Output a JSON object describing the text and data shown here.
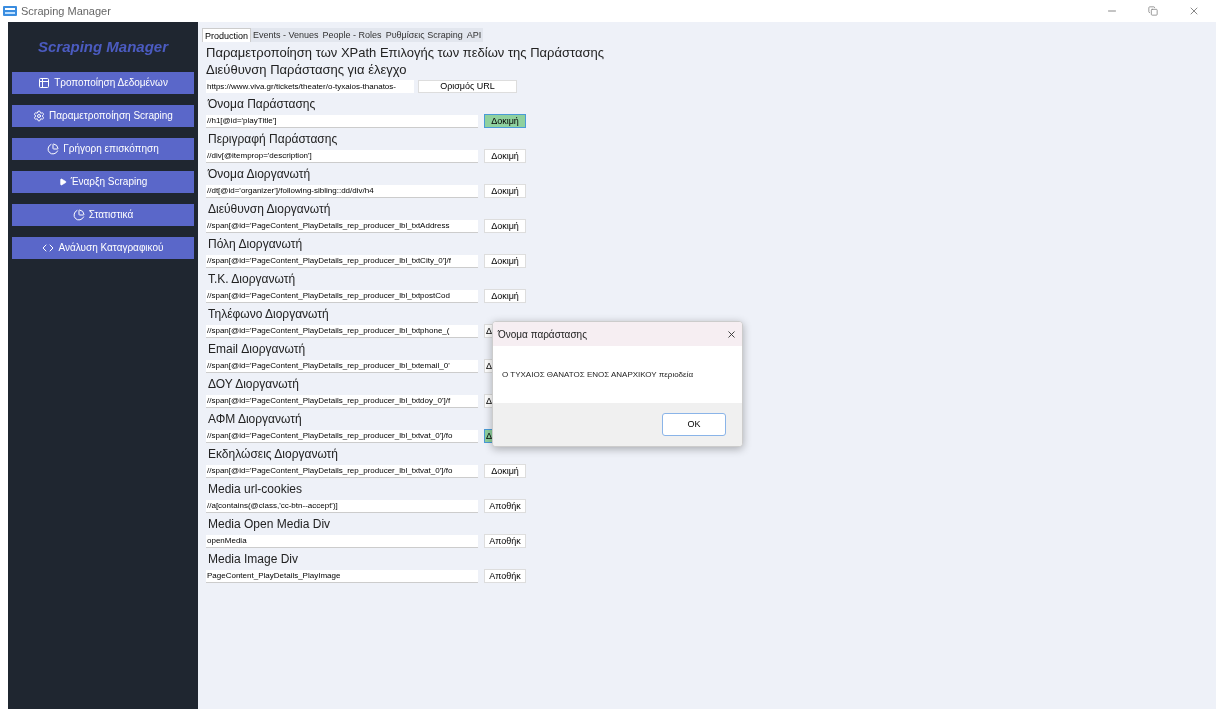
{
  "window": {
    "title": "Scraping Manager"
  },
  "sidebar": {
    "title": "Scraping Manager",
    "items": [
      {
        "label": "Τροποποίηση Δεδομένων",
        "kind": "table"
      },
      {
        "label": "Παραμετροποίηση Scraping",
        "kind": "gear"
      },
      {
        "label": "Γρήγορη επισκόπηση",
        "kind": "pie"
      },
      {
        "label": "Έναρξη Scraping",
        "kind": "play"
      },
      {
        "label": "Στατιστικά",
        "kind": "pie"
      },
      {
        "label": "Ανάλυση Καταγραφικού",
        "kind": "code"
      }
    ]
  },
  "tabs": [
    {
      "label": "Production",
      "selected": true
    },
    {
      "label": "Events - Venues",
      "selected": false
    },
    {
      "label": "People - Roles",
      "selected": false
    },
    {
      "label": "Ρυθμίσεις Scraping",
      "selected": false
    },
    {
      "label": "API",
      "selected": false
    }
  ],
  "heading": "Παραμετροποίηση των XPath Επιλογής των πεδίων της Παράστασης",
  "url": {
    "label": "Διεύθυνση Παράστασης για έλεγχο",
    "value": "https://www.viva.gr/tickets/theater/o-tyxaios-thanatos-",
    "button": "Ορισμός URL"
  },
  "fields": [
    {
      "label": "Όνομα Παράστασης",
      "value": "//h1[@id='playTitle']",
      "button": "Δοκιμή",
      "highlighted": true,
      "clipped": false
    },
    {
      "label": "Περιγραφή Παράστασης",
      "value": "//div[@itemprop='description']",
      "button": "Δοκιμή",
      "highlighted": false,
      "clipped": false
    },
    {
      "label": "Όνομα Διοργανωτή",
      "value": "//dt[@id='organizer']/following-sibling::dd/div/h4",
      "button": "Δοκιμή",
      "highlighted": false,
      "clipped": false
    },
    {
      "label": "Διεύθυνση Διοργανωτή",
      "value": "//span[@id='PageContent_PlayDetails_rep_producer_lbl_txtAddress",
      "button": "Δοκιμή",
      "highlighted": false,
      "clipped": false
    },
    {
      "label": "Πόλη Διοργανωτή",
      "value": "//span[@id='PageContent_PlayDetails_rep_producer_lbl_txtCity_0']/f",
      "button": "Δοκιμή",
      "highlighted": false,
      "clipped": false
    },
    {
      "label": "Τ.Κ. Διοργανωτή",
      "value": "//span[@id='PageContent_PlayDetails_rep_producer_lbl_txtpostCod",
      "button": "Δοκιμή",
      "highlighted": false,
      "clipped": false
    },
    {
      "label": "Τηλέφωνο Διοργανωτή",
      "value": "//span[@id='PageContent_PlayDetails_rep_producer_lbl_txtphone_(",
      "button": "Δ",
      "highlighted": false,
      "clipped": true
    },
    {
      "label": "Email Διοργανωτή",
      "value": "//span[@id='PageContent_PlayDetails_rep_producer_lbl_txtemail_0'",
      "button": "Δ",
      "highlighted": false,
      "clipped": true
    },
    {
      "label": "ΔΟΥ Διοργανωτή",
      "value": "//span[@id='PageContent_PlayDetails_rep_producer_lbl_txtdoy_0']/f",
      "button": "Δ",
      "highlighted": false,
      "clipped": true
    },
    {
      "label": "ΑΦΜ Διοργανωτή",
      "value": "//span[@id='PageContent_PlayDetails_rep_producer_lbl_txtvat_0']/fo",
      "button": "Δ",
      "highlighted": true,
      "clipped": true
    },
    {
      "label": "Εκδηλώσεις Διοργανωτή",
      "value": "//span[@id='PageContent_PlayDetails_rep_producer_lbl_txtvat_0']/fo",
      "button": "Δοκιμή",
      "highlighted": false,
      "clipped": false
    },
    {
      "label": "Media url-cookies",
      "value": "//a[contains(@class,'cc-btn--accept')]",
      "button": "Αποθήκ",
      "highlighted": false,
      "clipped": false
    },
    {
      "label": "Media Open Media Div",
      "value": "openMedia",
      "button": "Αποθήκ",
      "highlighted": false,
      "clipped": false
    },
    {
      "label": "Media Image Div",
      "value": "PageContent_PlayDetails_PlayImage",
      "button": "Αποθήκ",
      "highlighted": false,
      "clipped": false
    }
  ],
  "dialog": {
    "title": "Όνομα παράστασης",
    "message": "Ο ΤΥΧΑΙΟΣ ΘΑΝΑΤΟΣ ΕΝΟΣ ΑΝΑΡΧΙΚΟΥ περιοδεία",
    "button": "OK"
  }
}
